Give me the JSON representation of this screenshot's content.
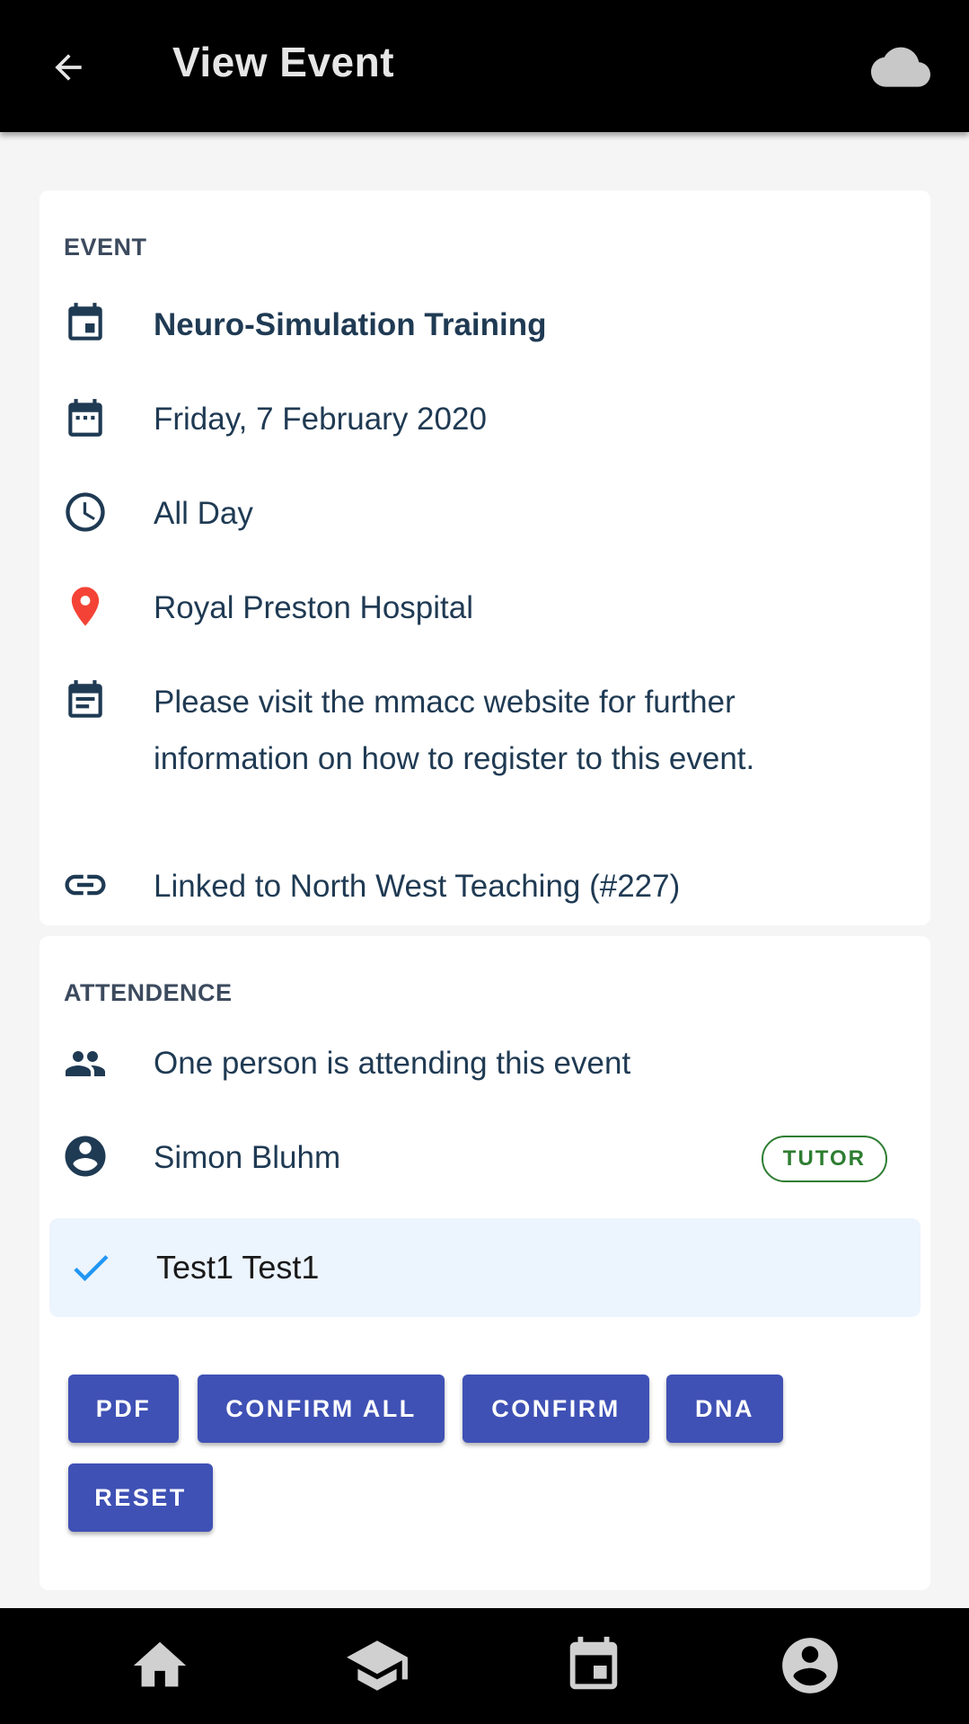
{
  "appbar": {
    "title": "View Event",
    "back_icon": "arrow-back-icon",
    "cloud_icon": "cloud-icon"
  },
  "event": {
    "section_label": "EVENT",
    "name": "Neuro-Simulation Training",
    "date": "Friday, 7 February 2020",
    "time": "All Day",
    "location": "Royal Preston Hospital",
    "description": "Please visit the mmacc website for further information on how to register to this event.",
    "linked": "Linked to North West Teaching (#227)"
  },
  "attendance": {
    "section_label": "ATTENDENCE",
    "summary": "One person is attending this event",
    "tutor": {
      "name": "Simon Bluhm",
      "badge": "TUTOR"
    },
    "selected_attendee": {
      "name": "Test1 Test1"
    },
    "buttons": {
      "pdf": "PDF",
      "confirm_all": "CONFIRM ALL",
      "confirm": "CONFIRM",
      "dna": "DNA",
      "reset": "RESET"
    }
  },
  "bottom_nav": {
    "items": [
      "home-icon",
      "school-icon",
      "event-icon",
      "account-icon"
    ]
  },
  "colors": {
    "primary": "#3f51b5",
    "text": "#1f3a53",
    "location_pin": "#f44336",
    "tutor_badge": "#2e7d32",
    "check": "#2196f3",
    "selected_bg": "#ecf4fd"
  }
}
